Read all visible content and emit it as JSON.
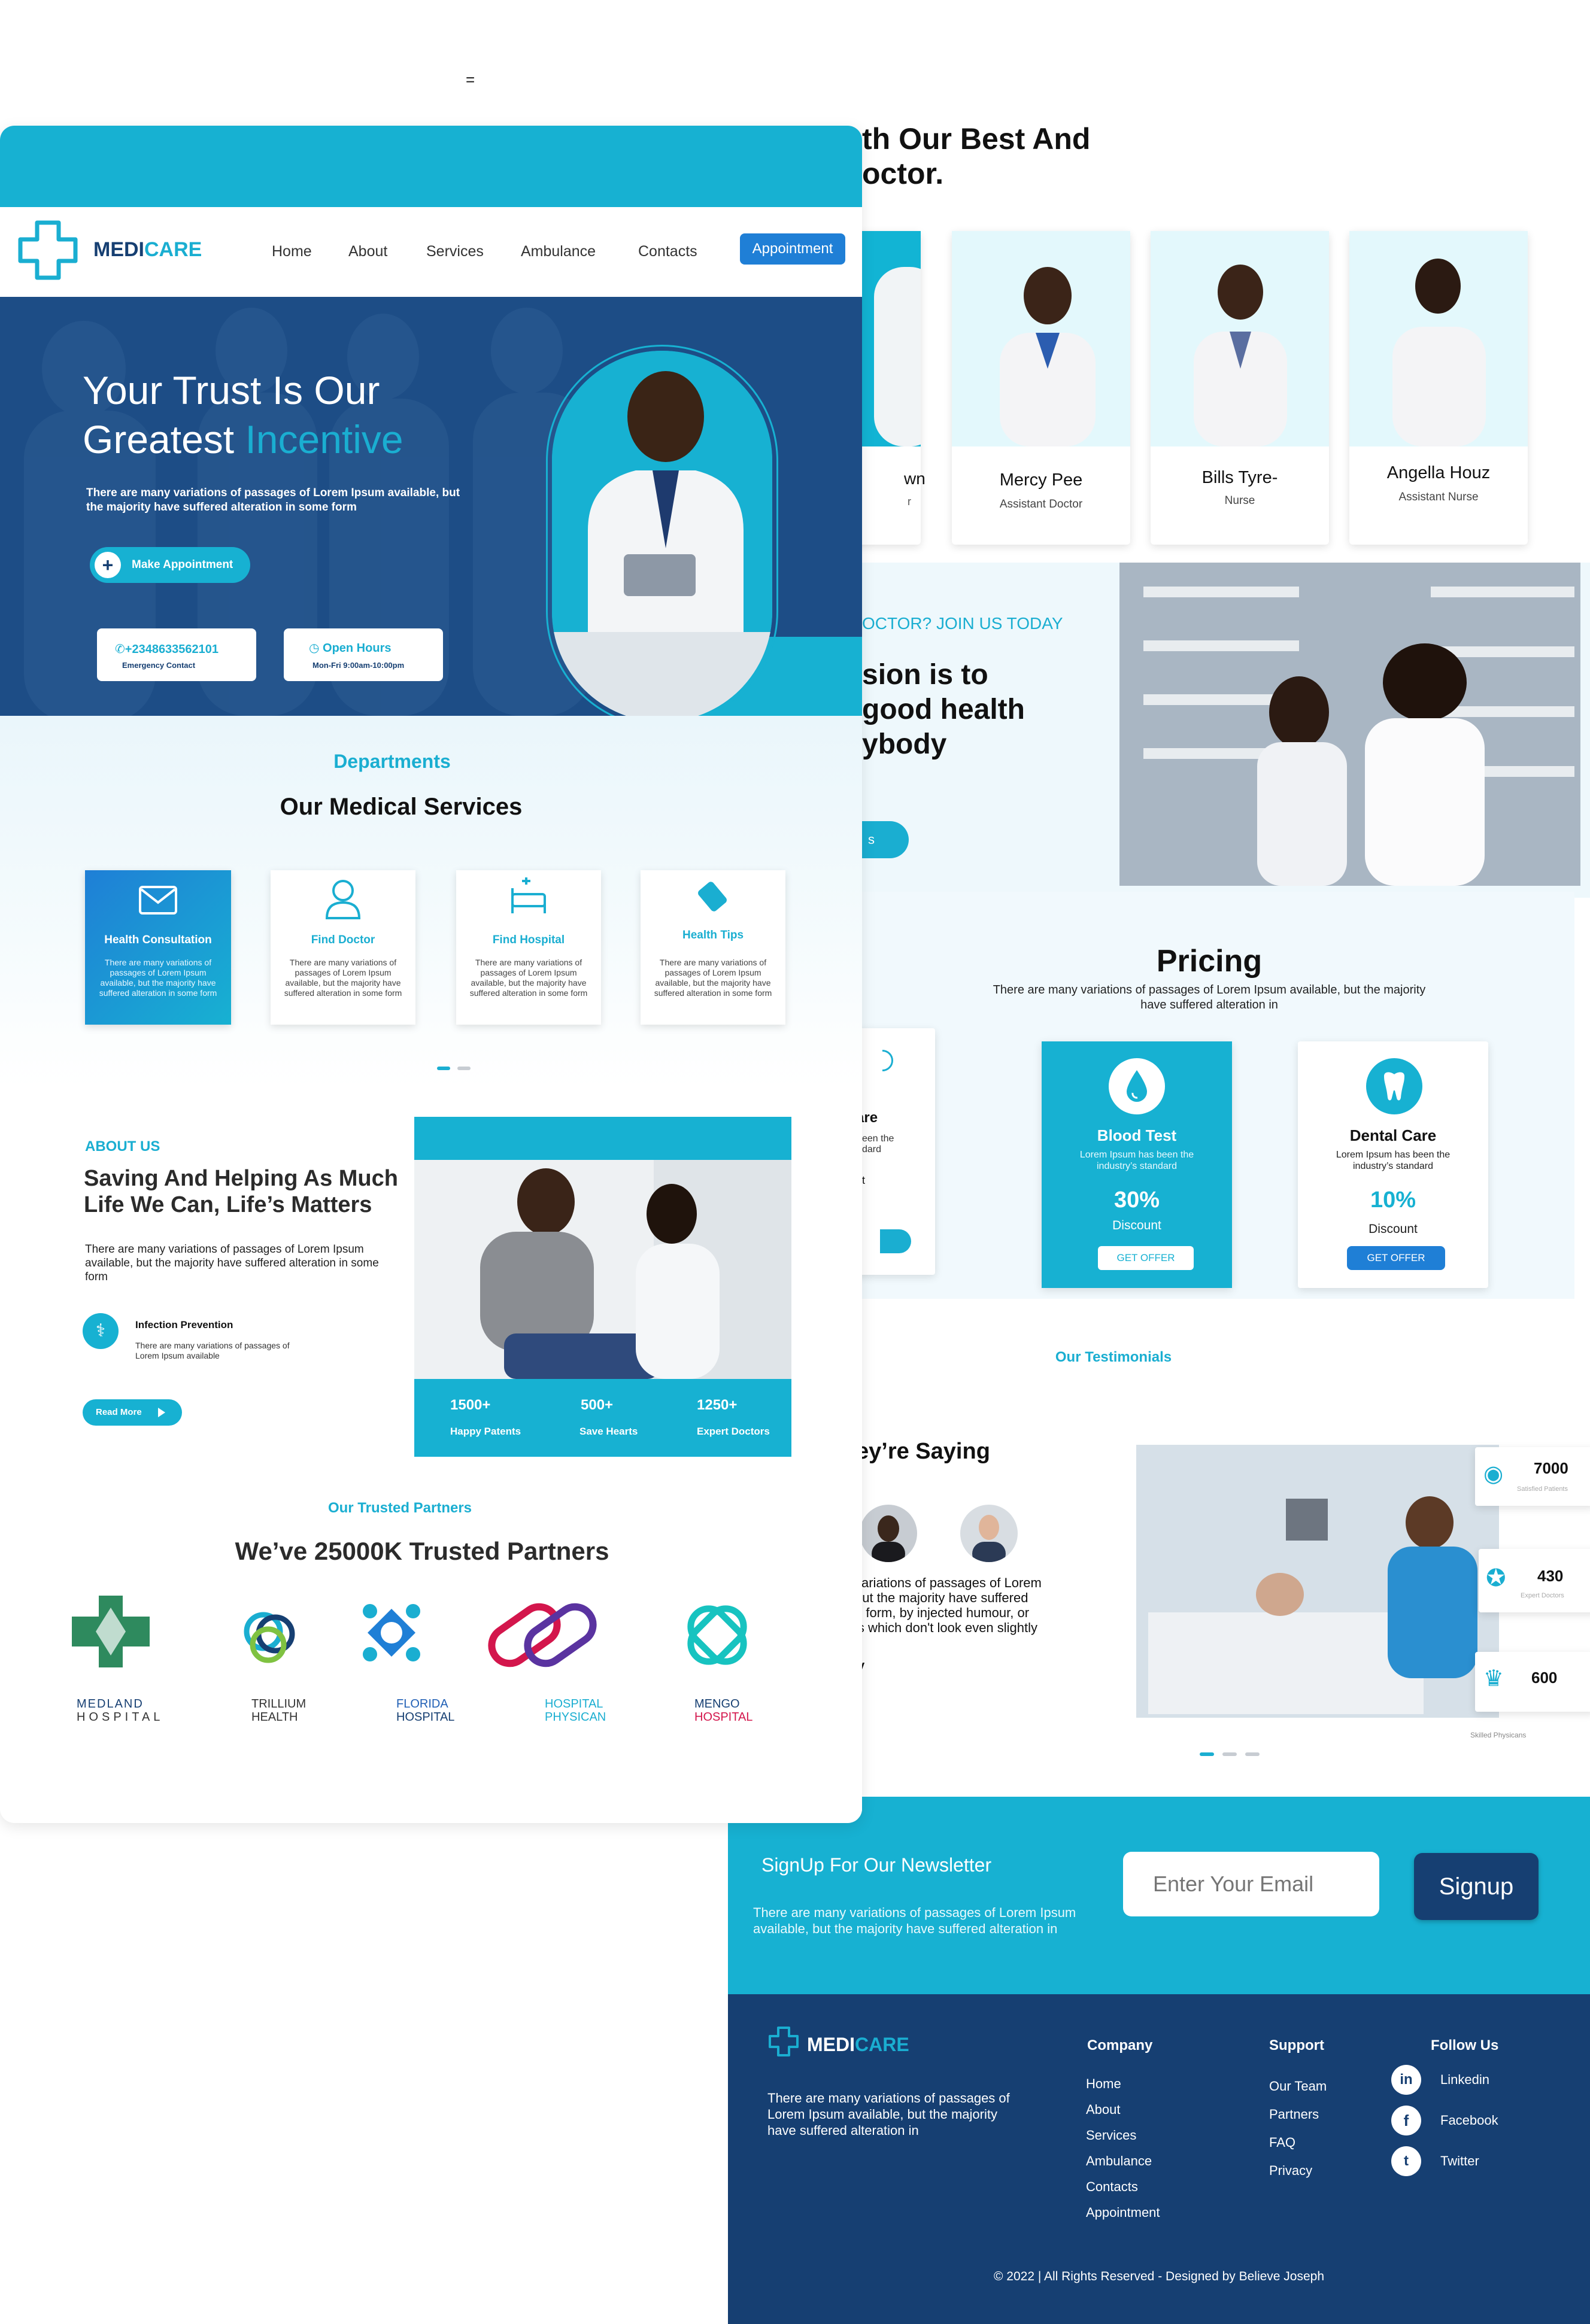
{
  "stray_mark": "=",
  "brand": {
    "part1": "MEDI",
    "part2": "CARE"
  },
  "nav": {
    "items": [
      "Home",
      "About",
      "Services",
      "Ambulance",
      "Contacts"
    ],
    "cta": "Appointment"
  },
  "hero": {
    "title_line1": "Your Trust Is Our",
    "title_line2a": "Greatest ",
    "title_line2b": "Incentive",
    "text": "There are many variations of passages of Lorem Ipsum available, but the majority have suffered alteration in some form",
    "cta": "Make Appointment",
    "phone": "+2348633562101",
    "phone_sub": "Emergency Contact",
    "hours": "Open Hours",
    "hours_sub": "Mon-Fri 9:00am-10:00pm"
  },
  "departments": {
    "eyebrow": "Departments",
    "title": "Our Medical Services",
    "cards": [
      {
        "icon": "envelope-icon",
        "title": "Health Consultation",
        "text": "There are many variations of passages of Lorem Ipsum available, but the majority have suffered alteration in some form"
      },
      {
        "icon": "doctor-icon",
        "title": "Find Doctor",
        "text": "There are many variations of passages of Lorem Ipsum available, but the majority have suffered alteration in some form"
      },
      {
        "icon": "hospital-bed-icon",
        "title": "Find Hospital",
        "text": "There are many variations of passages of Lorem Ipsum available, but the majority have suffered alteration in some form"
      },
      {
        "icon": "pill-bottle-icon",
        "title": "Health Tips",
        "text": "There are many variations of passages of Lorem Ipsum available, but the majority have suffered alteration in some form"
      }
    ]
  },
  "about": {
    "eyebrow": "ABOUT US",
    "title_line1": "Saving  And Helping As Much",
    "title_line2": "Life We Can, Life’s Matters",
    "text": "There are many variations of passages of Lorem Ipsum available, but the majority have suffered alteration in some form",
    "feature_title": "Infection Prevention",
    "feature_text": "There are many variations of passages of Lorem Ipsum available",
    "cta": "Read More",
    "stats": [
      {
        "value": "1500+",
        "label": "Happy Patents"
      },
      {
        "value": "500+",
        "label": "Save Hearts"
      },
      {
        "value": "1250+",
        "label": "Expert Doctors"
      }
    ]
  },
  "partners": {
    "eyebrow": "Our Trusted Partners",
    "title": "We’ve 25000K Trusted Partners",
    "logos": [
      {
        "line1": "MEDLAND",
        "line2": "HOSPITAL",
        "c1": "#163f72",
        "c2": "#333333"
      },
      {
        "line1": "TRILLIUM",
        "line2": "HEALTH",
        "c1": "#333333",
        "c2": "#333333"
      },
      {
        "line1": "FLORIDA",
        "line2": "HOSPITAL",
        "c1": "#1f5fb5",
        "c2": "#163f72"
      },
      {
        "line1": "HOSPITAL",
        "line2": "PHYSICAN",
        "c1": "#1aaed1",
        "c2": "#1aaed1"
      },
      {
        "line1": "MENGO",
        "line2": "HOSPITAL",
        "c1": "#163f72",
        "c2": "#d3164c"
      }
    ]
  },
  "team": {
    "title_line1": "th Our Best And",
    "title_line2": "octor.",
    "members": [
      {
        "name": "wn",
        "role": "r"
      },
      {
        "name": "Mercy Pee",
        "role": "Assistant Doctor"
      },
      {
        "name": "Bills Tyre-",
        "role": "Nurse"
      },
      {
        "name": "Angella Houz",
        "role": "Assistant Nurse"
      }
    ]
  },
  "join": {
    "eyebrow": "OCTOR? JOIN US TODAY",
    "title_line1": "sion is to",
    "title_line2": "good health",
    "title_line3": "ybody",
    "cta": "s"
  },
  "pricing": {
    "title": "Pricing",
    "text": "There are many variations of passages of Lorem Ipsum available, but the majority have suffered alteration in",
    "partial_card": {
      "title": "are",
      "text": "een the\ndard",
      "note": "t"
    },
    "cards": [
      {
        "icon": "blood-drop-icon",
        "title": "Blood Test",
        "text": "Lorem Ipsum has been the industry’s standard",
        "value": "30%",
        "label": "Discount",
        "cta": "GET OFFER"
      },
      {
        "icon": "tooth-icon",
        "title": "Dental Care",
        "text": "Lorem Ipsum has been the industry’s standard",
        "value": "10%",
        "label": "Discount",
        "cta": "GET OFFER"
      }
    ]
  },
  "testimonials": {
    "eyebrow": "Our Testimonials",
    "title": "ey’re Saying",
    "quote_line1": "variations of passages of Lorem",
    "quote_line2": "out the majority have suffered",
    "quote_line3": "e form, by injected humour, or",
    "quote_line4": "ls which don't look even slightly",
    "sign": "y",
    "stats": [
      {
        "icon": "patients-icon",
        "value": "7000",
        "label": "Satisfied Patients"
      },
      {
        "icon": "award-icon",
        "value": "430",
        "label": "Expert Doctors"
      },
      {
        "icon": "trophy-icon",
        "value": "600",
        "label": "Skilled Physicans"
      }
    ]
  },
  "newsletter": {
    "title": "SignUp For Our Newsletter",
    "text": "There are many variations of passages of Lorem Ipsum available, but the majority have suffered alteration in",
    "placeholder": "Enter Your Email",
    "cta": "Signup"
  },
  "footer": {
    "about": "There are many variations of passages of Lorem Ipsum available, but the majority have suffered alteration in",
    "company_title": "Company",
    "company": [
      "Home",
      "About",
      "Services",
      "Ambulance",
      "Contacts",
      "Appointment"
    ],
    "support_title": "Support",
    "support": [
      "Our Team",
      "Partners",
      "FAQ",
      "Privacy"
    ],
    "follow_title": "Follow Us",
    "social": [
      {
        "icon": "linkedin-icon",
        "label": "Linkedin",
        "glyph": "in"
      },
      {
        "icon": "facebook-icon",
        "label": "Facebook",
        "glyph": "f"
      },
      {
        "icon": "twitter-icon",
        "label": "Twitter",
        "glyph": "t"
      }
    ],
    "copyright": "© 2022 | All Rights Reserved - Designed by  Believe Joseph"
  },
  "colors": {
    "teal": "#1aaed1",
    "navy": "#163f72",
    "hero_bg": "#1d4d86",
    "light_bg": "#eaf6fb"
  }
}
